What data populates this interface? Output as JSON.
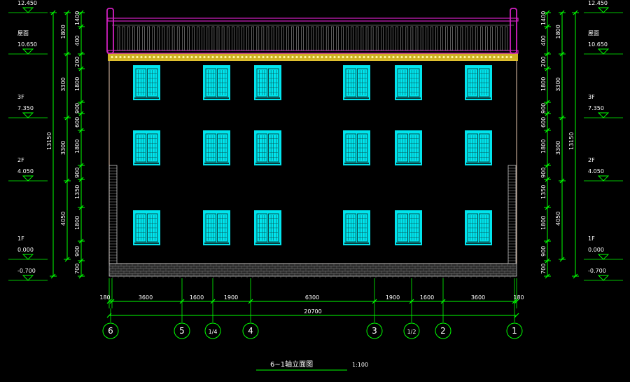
{
  "title": "6~1轴立面图",
  "scale": "1:100",
  "colors": {
    "background": "#000000",
    "dim_line": "#00ff00",
    "window": "#00e5ee",
    "window_detail": "#0b3b3b",
    "parapet": "#d020c0",
    "outline": "#e8c8b0",
    "cornice": "#f2d028",
    "brick": "#c8c8c8",
    "text": "#ffffff"
  },
  "levels": [
    {
      "name": "",
      "elev": "12.450"
    },
    {
      "name": "屋面",
      "elev": "10.650"
    },
    {
      "name": "3F",
      "elev": "7.350"
    },
    {
      "name": "2F",
      "elev": "4.050"
    },
    {
      "name": "1F",
      "elev": "0.000"
    },
    {
      "name": "",
      "elev": "-0.700"
    }
  ],
  "vertical_dims": {
    "detail": [
      "1400",
      "400",
      "200",
      "1800",
      "900",
      "600",
      "1800",
      "900",
      "1350",
      "1800",
      "900",
      "700"
    ],
    "floor": [
      "1800",
      "3300",
      "3300",
      "4050"
    ],
    "total": "13150"
  },
  "horizontal_dims": {
    "segments": [
      "180",
      "3600",
      "1600",
      "1900",
      "6300",
      "1900",
      "1600",
      "3600",
      "180"
    ],
    "total": "20700"
  },
  "axes": [
    "6",
    "5",
    "1/4",
    "4",
    "3",
    "1/2",
    "2",
    "1"
  ]
}
